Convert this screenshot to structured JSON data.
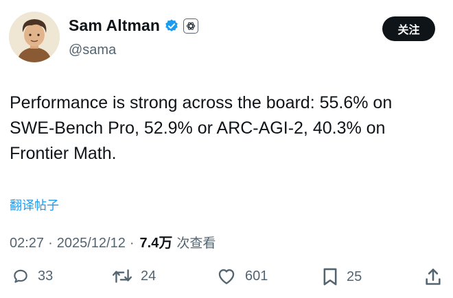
{
  "author": {
    "name": "Sam Altman",
    "handle": "@sama",
    "verified": true
  },
  "follow_button": {
    "label": "关注"
  },
  "tweet": {
    "lines": [
      "Performance is strong across the board: 55.6% on",
      "SWE-Bench Pro, 52.9% or ARC-AGI-2, 40.3% on",
      "Frontier Math."
    ]
  },
  "translate_link": "翻译帖子",
  "meta": {
    "time": "02:27",
    "separator": "·",
    "date": "2025/12/12",
    "views_count": "7.4万",
    "views_label": "次查看"
  },
  "actions": {
    "replies": "33",
    "reposts": "24",
    "likes": "601",
    "bookmarks": "25"
  },
  "icons": {
    "verified": "verified-check-icon",
    "org": "openai-logo-icon",
    "reply": "reply-icon",
    "repost": "repost-icon",
    "like": "heart-icon",
    "bookmark": "bookmark-icon",
    "share": "share-icon"
  },
  "colors": {
    "accent": "#1d9bf0",
    "text": "#0f1419",
    "muted": "#536471",
    "button_bg": "#0f1419"
  }
}
